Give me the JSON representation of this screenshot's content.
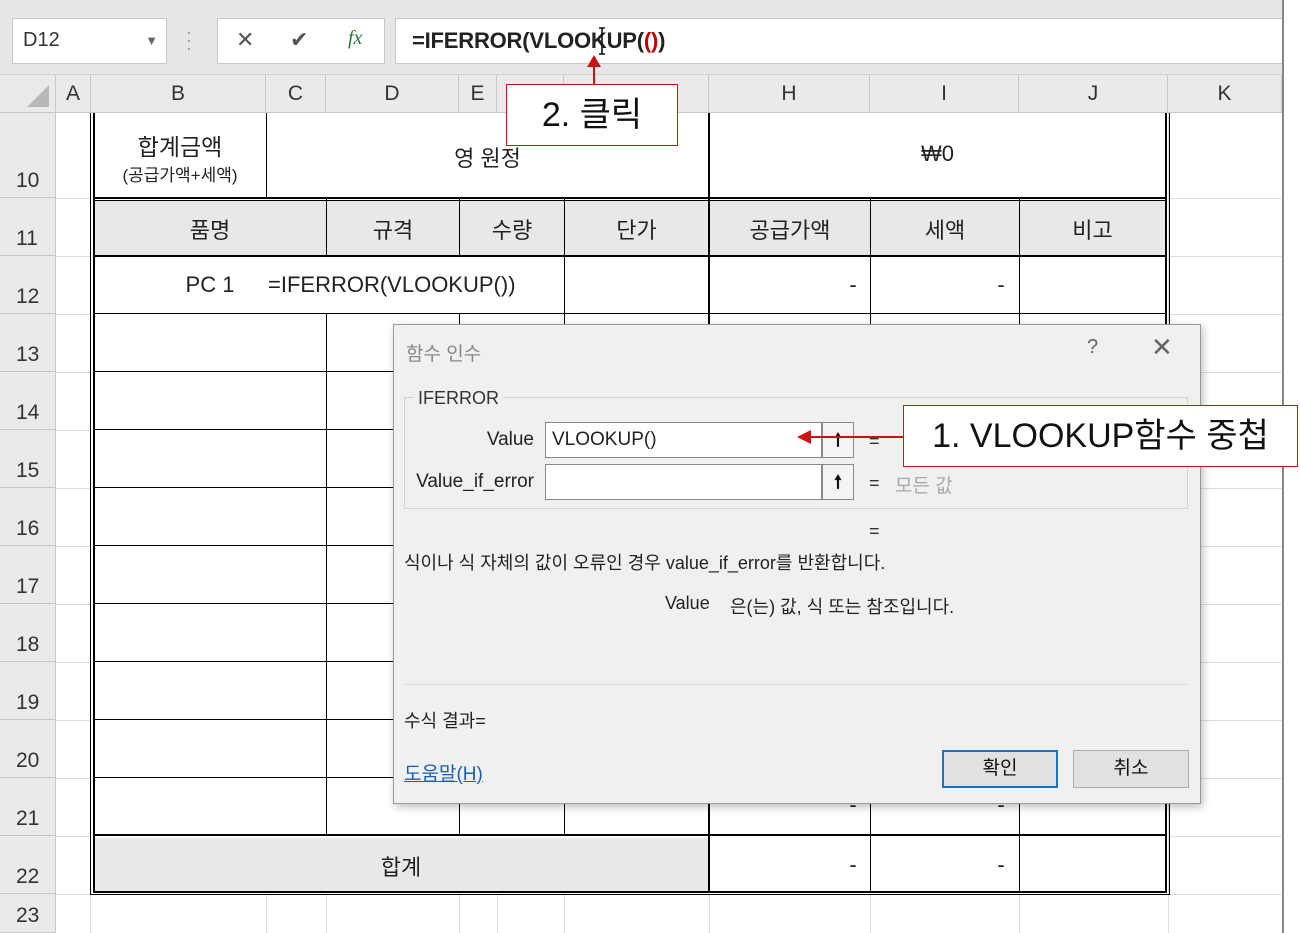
{
  "formula_bar": {
    "name_box": "D12",
    "formula_main": "=IFERROR(VLOOKUP(",
    "formula_paren": "()",
    "formula_close": ")",
    "icons": [
      "cancel-icon",
      "enter-icon",
      "insert-function-icon"
    ]
  },
  "columns": [
    "A",
    "B",
    "C",
    "D",
    "E",
    "F",
    "G",
    "H",
    "I",
    "J",
    "K"
  ],
  "rows": [
    "10",
    "11",
    "12",
    "13",
    "14",
    "15",
    "16",
    "17",
    "18",
    "19",
    "20",
    "21",
    "22",
    "23"
  ],
  "sheet": {
    "total_label": "합계금액",
    "total_sub": "(공급가액+세액)",
    "korean_amount": "영 원정",
    "won_amount": "₩0",
    "headers": {
      "item": "품명",
      "spec": "규격",
      "qty": "수량",
      "price": "단가",
      "supply": "공급가액",
      "tax": "세액",
      "note": "비고"
    },
    "row12_item": "PC 1",
    "row12_formula": "=IFERROR(VLOOKUP())",
    "dash": "-",
    "sum_label": "합계"
  },
  "dialog": {
    "title": "함수 인수",
    "help_glyph": "?",
    "close_glyph": "✕",
    "function_name": "IFERROR",
    "args": [
      {
        "label": "Value",
        "value": "VLOOKUP()",
        "eq": "=",
        "result": ""
      },
      {
        "label": "Value_if_error",
        "value": "",
        "eq": "=",
        "result": "모든 값"
      }
    ],
    "result_eq": "=",
    "description": "식이나 식 자체의 값이 오류인 경우 value_if_error를 반환합니다.",
    "arg_desc_name": "Value",
    "arg_desc_text": "은(는) 값, 식 또는 참조입니다.",
    "formula_result": "수식 결과=",
    "help_link": "도움말(H)",
    "ok": "확인",
    "cancel": "취소"
  },
  "callouts": {
    "step1": "1. VLOOKUP함수 중첩",
    "step2": "2. 클릭",
    "color": "#d01010"
  }
}
